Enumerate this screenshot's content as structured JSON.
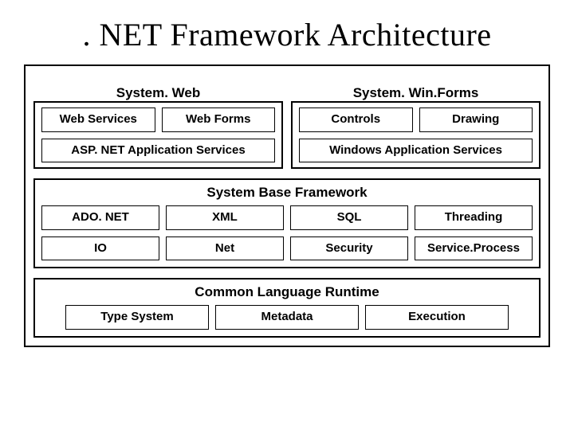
{
  "title": ". NET Framework Architecture",
  "top": {
    "left": {
      "title": "System. Web",
      "row1": [
        "Web Services",
        "Web Forms"
      ],
      "row2": "ASP. NET Application Services"
    },
    "right": {
      "title": "System. Win.Forms",
      "row1": [
        "Controls",
        "Drawing"
      ],
      "row2": "Windows Application Services"
    }
  },
  "base": {
    "title": "System Base Framework",
    "row1": [
      "ADO. NET",
      "XML",
      "SQL",
      "Threading"
    ],
    "row2": [
      "IO",
      "Net",
      "Security",
      "Service.Process"
    ]
  },
  "clr": {
    "title": "Common Language Runtime",
    "row": [
      "Type System",
      "Metadata",
      "Execution"
    ]
  }
}
